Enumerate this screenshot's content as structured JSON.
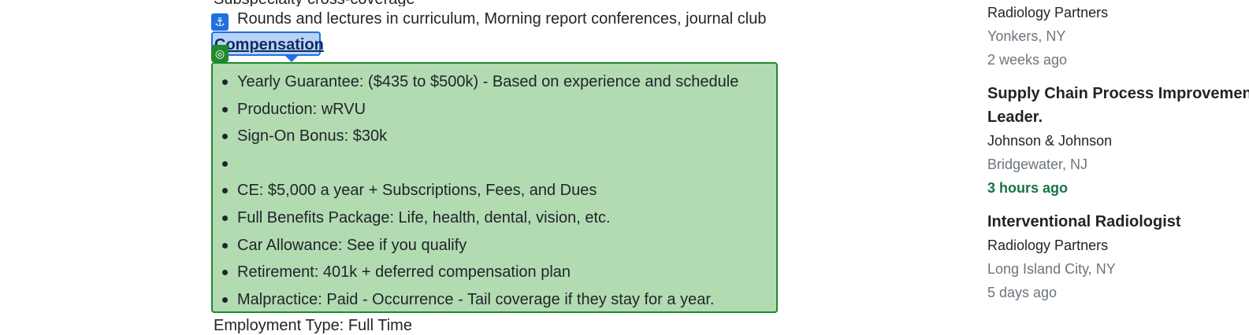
{
  "main": {
    "top_cut_text": "Subspecialty cross-coverage",
    "rounds_text": "Rounds and lectures in curriculum, Morning report conferences, journal club",
    "anchor_icon": "⚓",
    "target_icon": "◎",
    "compensation_heading": "Compensation",
    "compensation_items": [
      "Yearly Guarantee: ($435 to $500k) - Based on experience and schedule",
      "Production: wRVU",
      "Sign-On Bonus: $30k",
      "",
      "CE: $5,000 a year + Subscriptions, Fees, and Dues",
      "Full Benefits Package: Life, health, dental, vision, etc.",
      "Car Allowance: See if you qualify",
      "Retirement: 401k + deferred compensation plan",
      "Malpractice: Paid - Occurrence - Tail coverage if they stay for a year."
    ],
    "employment_type": "Employment Type: Full Time"
  },
  "sidebar": {
    "jobs": [
      {
        "company": "Radiology Partners",
        "location": "Yonkers, NY",
        "posted": "2 weeks ago"
      },
      {
        "title_line1": "Supply Chain Process Improvement",
        "title_line2": "Leader.",
        "company": "Johnson & Johnson",
        "location": "Bridgewater, NJ",
        "posted": "3 hours ago"
      },
      {
        "title_line1": "Interventional Radiologist",
        "company": "Radiology Partners",
        "location": "Long Island City, NY",
        "posted": "5 days ago"
      }
    ]
  },
  "colors": {
    "anchor_highlight": "#1f6fe0",
    "target_highlight": "#1e8a2c",
    "recent_posted": "#157347"
  }
}
